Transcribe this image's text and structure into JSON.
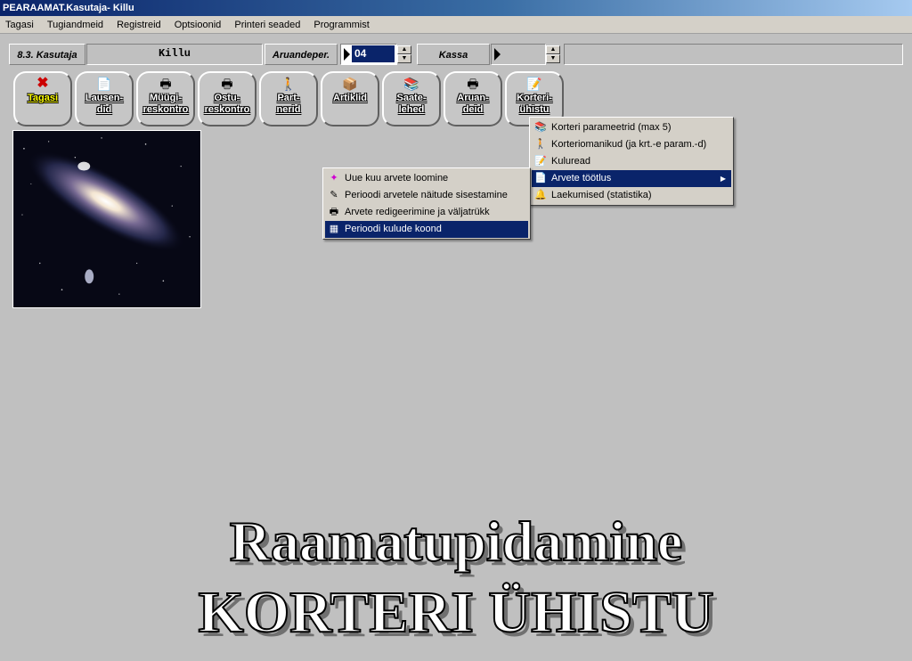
{
  "window": {
    "title": "PEARAAMAT.Kasutaja- Killu"
  },
  "menubar": [
    "Tagasi",
    "Tugiandmeid",
    "Registreid",
    "Optsioonid",
    "Printeri seaded",
    "Programmist"
  ],
  "header": {
    "user_label": "8.3. Kasutaja",
    "user_value": "Killu",
    "period_label": "Aruandeper.",
    "period_value": "04",
    "kassa_label": "Kassa",
    "kassa_value": ""
  },
  "toolbar": [
    {
      "label": "Tagasi",
      "icon": "close-x-icon"
    },
    {
      "label": "Lausen-\ndid",
      "icon": "documents-icon"
    },
    {
      "label": "Müügi-\nreskontro",
      "icon": "printer-icon"
    },
    {
      "label": "Ostu-\nreskontro",
      "icon": "printer-icon"
    },
    {
      "label": "Part-\nnerid",
      "icon": "person-icon"
    },
    {
      "label": "Artiklid",
      "icon": "package-icon"
    },
    {
      "label": "Saate-\nlehed",
      "icon": "books-icon"
    },
    {
      "label": "Aruan-\ndeid",
      "icon": "printer-icon"
    },
    {
      "label": "Korteri-\nühistu",
      "icon": "notepad-icon"
    }
  ],
  "menu_main": [
    {
      "label": "Korteri parameetrid (max 5)",
      "icon": "books-icon"
    },
    {
      "label": "Korteriomanikud (ja krt.-e param.-d)",
      "icon": "person-icon"
    },
    {
      "label": "Kuluread",
      "icon": "notepad-icon"
    },
    {
      "label": "Arvete töötlus",
      "icon": "document-icon",
      "selected": true,
      "submenu": true
    },
    {
      "label": "Laekumised (statistika)",
      "icon": "bell-icon"
    }
  ],
  "menu_sub": [
    {
      "label": "Uue kuu arvete loomine",
      "icon": "sparkle-icon"
    },
    {
      "label": "Perioodi arvetele näitude sisestamine",
      "icon": "pencil-icon"
    },
    {
      "label": "Arvete redigeerimine ja väljatrükk",
      "icon": "printer-icon"
    },
    {
      "label": "Perioodi kulude koond",
      "icon": "calculator-icon",
      "selected": true
    }
  ],
  "banner": {
    "line1": "Raamatupidamine",
    "line2": "KORTERI ÜHISTU"
  },
  "colors": {
    "titlebar": "#0a246a",
    "selection": "#0a246a",
    "background": "#c0c0c0",
    "menu": "#d4d0c8"
  }
}
